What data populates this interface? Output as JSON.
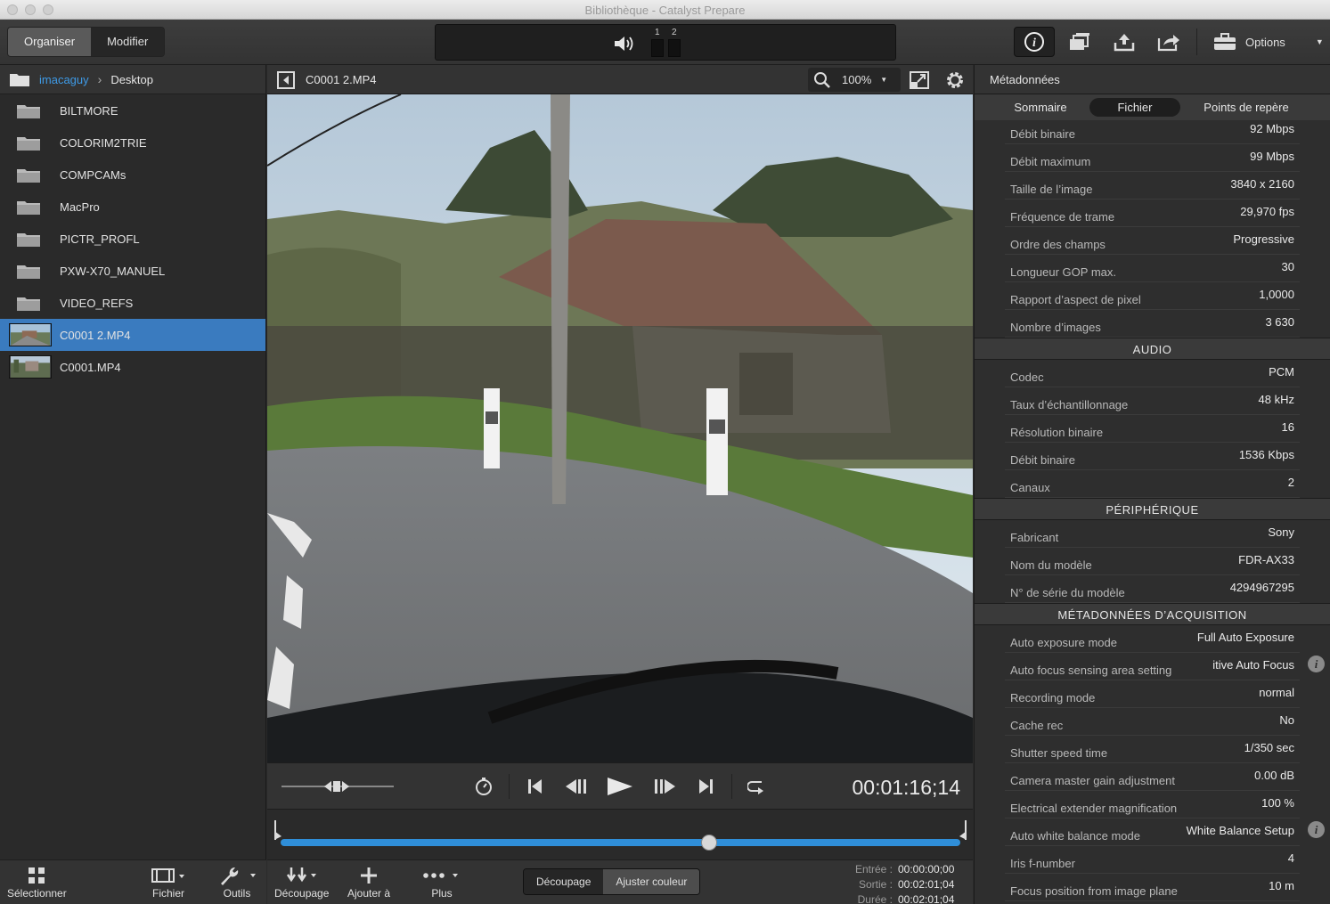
{
  "window": {
    "title": "Bibliothèque - Catalyst Prepare"
  },
  "toolbar": {
    "organiser_label": "Organiser",
    "modifier_label": "Modifier",
    "meter_1": "1",
    "meter_2": "2",
    "options_label": "Options"
  },
  "browser": {
    "breadcrumb_user": "imacaguy",
    "breadcrumb_current": "Desktop",
    "folders": [
      "BILTMORE",
      "COLORIM2TRIE",
      "COMPCAMs",
      "MacPro",
      "PICTR_PROFL",
      "PXW-X70_MANUEL",
      "VIDEO_REFS"
    ],
    "files": [
      "C0001 2.MP4",
      "C0001.MP4"
    ],
    "selected_file": "C0001 2.MP4"
  },
  "left_tools": {
    "select_label": "Sélectionner",
    "file_label": "Fichier",
    "tools_label": "Outils"
  },
  "viewer": {
    "filename": "C0001 2.MP4",
    "zoom": "100%",
    "timecode": "00:01:16;14",
    "playhead_position": 0.63
  },
  "viewer_tools": {
    "cut_label": "Découpage",
    "add_label": "Ajouter à",
    "more_label": "Plus",
    "mode_cut": "Découpage",
    "mode_color": "Ajuster couleur",
    "in_label": "Entrée :",
    "in_value": "00:00:00;00",
    "out_label": "Sortie :",
    "out_value": "00:02:01;04",
    "dur_label": "Durée :",
    "dur_value": "00:02:01;04"
  },
  "metadata": {
    "title": "Métadonnées",
    "tabs": [
      "Sommaire",
      "Fichier",
      "Points de repère"
    ],
    "active_tab": "Fichier",
    "video_rows": [
      {
        "k": "Débit binaire",
        "v": "92 Mbps"
      },
      {
        "k": "Débit maximum",
        "v": "99 Mbps"
      },
      {
        "k": "Taille de l’image",
        "v": "3840 x 2160"
      },
      {
        "k": "Fréquence de trame",
        "v": "29,970 fps"
      },
      {
        "k": "Ordre des champs",
        "v": "Progressive"
      },
      {
        "k": "Longueur GOP max.",
        "v": "30"
      },
      {
        "k": "Rapport d’aspect de pixel",
        "v": "1,0000"
      },
      {
        "k": "Nombre d’images",
        "v": "3 630"
      }
    ],
    "audio_title": "AUDIO",
    "audio_rows": [
      {
        "k": "Codec",
        "v": "PCM"
      },
      {
        "k": "Taux d’échantillonnage",
        "v": "48 kHz"
      },
      {
        "k": "Résolution binaire",
        "v": "16"
      },
      {
        "k": "Débit binaire",
        "v": "1536 Kbps"
      },
      {
        "k": "Canaux",
        "v": "2"
      }
    ],
    "device_title": "PÉRIPHÉRIQUE",
    "device_rows": [
      {
        "k": "Fabricant",
        "v": "Sony"
      },
      {
        "k": "Nom du modèle",
        "v": "FDR-AX33"
      },
      {
        "k": "N° de série du modèle",
        "v": "4294967295"
      }
    ],
    "acq_title": "MÉTADONNÉES D’ACQUISITION",
    "acq_rows": [
      {
        "k": "Auto exposure mode",
        "v": "Full Auto Exposure"
      },
      {
        "k": "Auto focus sensing area setting",
        "v": "itive Auto Focus",
        "info": true
      },
      {
        "k": "Recording mode",
        "v": "normal"
      },
      {
        "k": "Cache rec",
        "v": "No"
      },
      {
        "k": "Shutter speed time",
        "v": "1/350 sec"
      },
      {
        "k": "Camera master gain adjustment",
        "v": "0.00 dB"
      },
      {
        "k": "Electrical extender magnification",
        "v": "100 %"
      },
      {
        "k": "Auto white balance mode",
        "v": "White Balance Setup",
        "info": true
      },
      {
        "k": "Iris f-number",
        "v": "4"
      },
      {
        "k": "Focus position from image plane",
        "v": "10 m"
      }
    ]
  }
}
